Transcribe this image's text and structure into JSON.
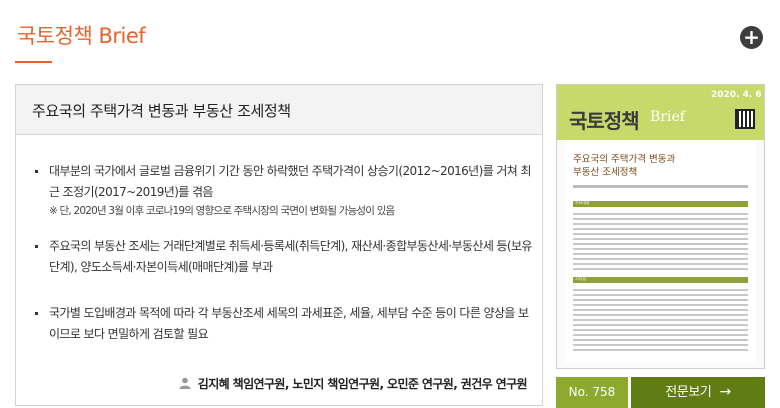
{
  "header": {
    "title": "국토정책 Brief",
    "add_label": "+"
  },
  "article": {
    "title": "주요국의 주택가격 변동과 부동산 조세정책",
    "bullets": [
      {
        "text": "대부분의 국가에서 글로벌 금융위기 기간 동안 하락했던 주택가격이 상승기(2012~2016년)를 거쳐 최근 조정기(2017~2019년)를 겪음",
        "note": "※ 단, 2020년 3월 이후 코로나19의 영향으로 주택시장의 국면이 변화될 가능성이 있음"
      },
      {
        "text": "주요국의 부동산 조세는 거래단계별로 취득세·등록세(취득단계), 재산세·종합부동산세·부동산세 등(보유단계), 양도소득세·자본이득세(매매단계)를 부과"
      },
      {
        "text": "국가별 도입배경과 목적에 따라 각 부동산조세 세목의 과세표준, 세율, 세부담 수준 등이 다른 양상을 보이므로 보다 면밀하게 검토할 필요"
      }
    ],
    "authors": "김지혜 책임연구원, 노민지 책임연구원, 오민준 연구원, 권건우 연구원"
  },
  "cover": {
    "date": "2020. 4. 6",
    "logo": "국토정책",
    "logo_en": "Brief",
    "headline_line1": "주요국의 주택가격 변동과",
    "headline_line2": "부동산 조세정책",
    "section1": "주요내용",
    "section2": "시사점"
  },
  "footer": {
    "issue_no": "No. 758",
    "view_label": "전문보기",
    "view_arrow": "→"
  },
  "colors": {
    "brand": "#e8632b",
    "badge_green": "#8cab2e",
    "button_green": "#5f7d14"
  }
}
